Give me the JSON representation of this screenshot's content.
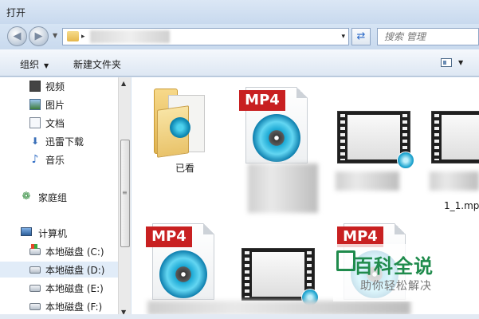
{
  "window": {
    "title": "打开"
  },
  "address": {
    "separator": "▸",
    "dropdown": "▾"
  },
  "search": {
    "placeholder": "搜索 管理"
  },
  "toolbar": {
    "organize": "组织",
    "new_folder": "新建文件夹"
  },
  "sidebar": {
    "favorites": [
      {
        "label": "视频",
        "icon": "video-library-icon"
      },
      {
        "label": "图片",
        "icon": "pictures-library-icon"
      },
      {
        "label": "文档",
        "icon": "documents-library-icon"
      },
      {
        "label": "迅雷下载",
        "icon": "download-icon"
      },
      {
        "label": "音乐",
        "icon": "music-icon"
      }
    ],
    "homegroup": {
      "label": "家庭组",
      "icon": "homegroup-icon"
    },
    "computer": {
      "label": "计算机",
      "icon": "computer-icon"
    },
    "drives": [
      {
        "label": "本地磁盘 (C:)",
        "icon": "windows-drive-icon"
      },
      {
        "label": "本地磁盘 (D:)",
        "icon": "drive-icon",
        "selected": true
      },
      {
        "label": "本地磁盘 (E:)",
        "icon": "drive-icon"
      },
      {
        "label": "本地磁盘 (F:)",
        "icon": "drive-icon"
      }
    ]
  },
  "files": {
    "folder_label": "已看",
    "mp4_tag": "MP4",
    "partial_name": "1_1.mp"
  },
  "watermark": {
    "brand": "百科全说",
    "sub": "助你轻松解决"
  },
  "colors": {
    "mp4_tag": "#c82021",
    "watermark": "#1f8b4c",
    "selected": "#e1ecf8"
  }
}
